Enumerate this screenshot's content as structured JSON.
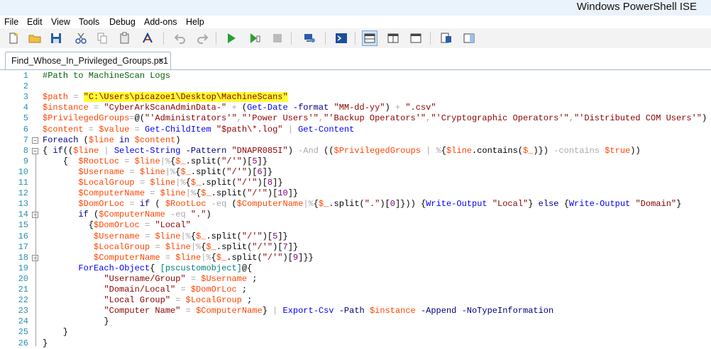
{
  "window": {
    "title": "Windows PowerShell ISE"
  },
  "menu": [
    "File",
    "Edit",
    "View",
    "Tools",
    "Debug",
    "Add-ons",
    "Help"
  ],
  "toolbar_icons": [
    "new-script-icon",
    "open-folder-icon",
    "save-icon",
    "cut-icon",
    "copy-icon",
    "paste-icon",
    "clear-console-icon",
    "undo-icon",
    "redo-icon",
    "run-script-icon",
    "run-selection-icon",
    "stop-icon",
    "new-remote-tab-icon",
    "start-powershell-icon",
    "show-script-top-icon",
    "show-script-right-icon",
    "show-script-maximized-icon",
    "show-script-pane-icon",
    "show-commands-icon"
  ],
  "tab": {
    "label": "Find_Whose_In_Privileged_Groups.ps1",
    "close": "×"
  },
  "colors": {
    "variable": "#ff4500",
    "string": "#8b0000",
    "command": "#0000ff",
    "operator": "#a9a9a9",
    "keyword": "#00008b",
    "type": "#008080",
    "comment": "#006400",
    "highlight": "#ffff33"
  },
  "code_lines": [
    [
      [
        "cmt",
        "#Path to MachineScan Logs"
      ]
    ],
    [],
    [
      [
        "var",
        "$path"
      ],
      [
        "op",
        " = "
      ],
      [
        "str-hl",
        "\"C:\\Users\\picazoe1\\Desktop\\MachineScans\""
      ]
    ],
    [
      [
        "var",
        "$instance"
      ],
      [
        "op",
        " = "
      ],
      [
        "str",
        "\"CyberArkScanAdminData-\""
      ],
      [
        "op",
        " + "
      ],
      [
        "plain",
        "("
      ],
      [
        "cmd",
        "Get-Date"
      ],
      [
        "plain",
        " "
      ],
      [
        "param",
        "-format"
      ],
      [
        "plain",
        " "
      ],
      [
        "str",
        "\"MM-dd-yy\""
      ],
      [
        "plain",
        ")"
      ],
      [
        "op",
        " + "
      ],
      [
        "str",
        "\".csv\""
      ]
    ],
    [
      [
        "var",
        "$PrivilegedGroups"
      ],
      [
        "op",
        "="
      ],
      [
        "plain",
        "@("
      ],
      [
        "str",
        "\"'Administrators'\""
      ],
      [
        "op",
        ","
      ],
      [
        "str",
        "\"'Power Users'\""
      ],
      [
        "op",
        ","
      ],
      [
        "str",
        "\"'Backup Operators'\""
      ],
      [
        "op",
        ","
      ],
      [
        "str",
        "\"'Cryptographic Operators'\""
      ],
      [
        "op",
        ","
      ],
      [
        "str",
        "\"'Distributed COM Users'\""
      ],
      [
        "plain",
        ")"
      ]
    ],
    [
      [
        "var",
        "$content"
      ],
      [
        "op",
        " = "
      ],
      [
        "var",
        "$value"
      ],
      [
        "op",
        " = "
      ],
      [
        "cmd",
        "Get-ChildItem"
      ],
      [
        "plain",
        " "
      ],
      [
        "str",
        "\"$path\\*.log\""
      ],
      [
        "op",
        " | "
      ],
      [
        "cmd",
        "Get-Content"
      ]
    ],
    [
      [
        "kw",
        "Foreach"
      ],
      [
        "plain",
        " ("
      ],
      [
        "var",
        "$line"
      ],
      [
        "plain",
        " "
      ],
      [
        "kw",
        "in"
      ],
      [
        "plain",
        " "
      ],
      [
        "var",
        "$content"
      ],
      [
        "plain",
        ")"
      ]
    ],
    [
      [
        "plain",
        "{ "
      ],
      [
        "kw",
        "if"
      ],
      [
        "plain",
        "(("
      ],
      [
        "var",
        "$line"
      ],
      [
        "op",
        " | "
      ],
      [
        "cmd",
        "Select-String"
      ],
      [
        "plain",
        " "
      ],
      [
        "param",
        "-Pattern"
      ],
      [
        "plain",
        " "
      ],
      [
        "str",
        "\"DNAPR085I\""
      ],
      [
        "plain",
        ")"
      ],
      [
        "op",
        " -And "
      ],
      [
        "plain",
        "(("
      ],
      [
        "var",
        "$PrivilegedGroups"
      ],
      [
        "op",
        " | "
      ],
      [
        "op",
        "%"
      ],
      [
        "plain",
        "{"
      ],
      [
        "var",
        "$line"
      ],
      [
        "plain",
        ".contains("
      ],
      [
        "var",
        "$_"
      ],
      [
        "plain",
        ")})"
      ],
      [
        "op",
        " -contains "
      ],
      [
        "var",
        "$true"
      ],
      [
        "plain",
        "))"
      ]
    ],
    [
      [
        "plain",
        "    {  "
      ],
      [
        "var",
        "$RootLoc"
      ],
      [
        "op",
        " = "
      ],
      [
        "var",
        "$line"
      ],
      [
        "op",
        "|%"
      ],
      [
        "plain",
        "{"
      ],
      [
        "var",
        "$_"
      ],
      [
        "plain",
        ".split("
      ],
      [
        "str",
        "\"/'\""
      ],
      [
        "plain",
        ")["
      ],
      [
        "num",
        "5"
      ],
      [
        "plain",
        "]}"
      ]
    ],
    [
      [
        "plain",
        "       "
      ],
      [
        "var",
        "$Username"
      ],
      [
        "op",
        " = "
      ],
      [
        "var",
        "$line"
      ],
      [
        "op",
        "|%"
      ],
      [
        "plain",
        "{"
      ],
      [
        "var",
        "$_"
      ],
      [
        "plain",
        ".split("
      ],
      [
        "str",
        "\"/'\""
      ],
      [
        "plain",
        ")["
      ],
      [
        "num",
        "6"
      ],
      [
        "plain",
        "]}"
      ]
    ],
    [
      [
        "plain",
        "       "
      ],
      [
        "var",
        "$LocalGroup"
      ],
      [
        "op",
        " = "
      ],
      [
        "var",
        "$line"
      ],
      [
        "op",
        "|%"
      ],
      [
        "plain",
        "{"
      ],
      [
        "var",
        "$_"
      ],
      [
        "plain",
        ".split("
      ],
      [
        "str",
        "\"/'\""
      ],
      [
        "plain",
        ")["
      ],
      [
        "num",
        "8"
      ],
      [
        "plain",
        "]}"
      ]
    ],
    [
      [
        "plain",
        "       "
      ],
      [
        "var",
        "$ComputerName"
      ],
      [
        "op",
        " = "
      ],
      [
        "var",
        "$line"
      ],
      [
        "op",
        "|%"
      ],
      [
        "plain",
        "{"
      ],
      [
        "var",
        "$_"
      ],
      [
        "plain",
        ".split("
      ],
      [
        "str",
        "\"/'\""
      ],
      [
        "plain",
        ")["
      ],
      [
        "num",
        "10"
      ],
      [
        "plain",
        "]}"
      ]
    ],
    [
      [
        "plain",
        "       "
      ],
      [
        "var",
        "$DomOrLoc"
      ],
      [
        "op",
        " = "
      ],
      [
        "kw",
        "if"
      ],
      [
        "plain",
        " ( "
      ],
      [
        "var",
        "$RootLoc"
      ],
      [
        "op",
        " -eq "
      ],
      [
        "plain",
        "("
      ],
      [
        "var",
        "$ComputerName"
      ],
      [
        "op",
        "|%"
      ],
      [
        "plain",
        "{"
      ],
      [
        "var",
        "$_"
      ],
      [
        "plain",
        ".split("
      ],
      [
        "str",
        "\".\""
      ],
      [
        "plain",
        ")["
      ],
      [
        "num",
        "0"
      ],
      [
        "plain",
        "]})) {"
      ],
      [
        "cmd",
        "Write-Output"
      ],
      [
        "plain",
        " "
      ],
      [
        "str",
        "\"Local\""
      ],
      [
        "plain",
        "} "
      ],
      [
        "kw",
        "else"
      ],
      [
        "plain",
        " {"
      ],
      [
        "cmd",
        "Write-Output"
      ],
      [
        "plain",
        " "
      ],
      [
        "str",
        "\"Domain\""
      ],
      [
        "plain",
        "}"
      ]
    ],
    [
      [
        "plain",
        "       "
      ],
      [
        "kw",
        "if"
      ],
      [
        "plain",
        " ("
      ],
      [
        "var",
        "$ComputerName"
      ],
      [
        "op",
        " -eq "
      ],
      [
        "str",
        "\".\""
      ],
      [
        "plain",
        ")"
      ]
    ],
    [
      [
        "plain",
        "         {"
      ],
      [
        "var",
        "$DomOrLoc"
      ],
      [
        "op",
        " = "
      ],
      [
        "str",
        "\"Local\""
      ]
    ],
    [
      [
        "plain",
        "          "
      ],
      [
        "var",
        "$Username"
      ],
      [
        "op",
        " = "
      ],
      [
        "var",
        "$line"
      ],
      [
        "op",
        "|%"
      ],
      [
        "plain",
        "{"
      ],
      [
        "var",
        "$_"
      ],
      [
        "plain",
        ".split("
      ],
      [
        "str",
        "\"/'\""
      ],
      [
        "plain",
        ")["
      ],
      [
        "num",
        "5"
      ],
      [
        "plain",
        "]}"
      ]
    ],
    [
      [
        "plain",
        "          "
      ],
      [
        "var",
        "$LocalGroup"
      ],
      [
        "op",
        " = "
      ],
      [
        "var",
        "$line"
      ],
      [
        "op",
        "|%"
      ],
      [
        "plain",
        "{"
      ],
      [
        "var",
        "$_"
      ],
      [
        "plain",
        ".split("
      ],
      [
        "str",
        "\"/'\""
      ],
      [
        "plain",
        ")["
      ],
      [
        "num",
        "7"
      ],
      [
        "plain",
        "]}"
      ]
    ],
    [
      [
        "plain",
        "          "
      ],
      [
        "var",
        "$ComputerName"
      ],
      [
        "op",
        " = "
      ],
      [
        "var",
        "$line"
      ],
      [
        "op",
        "|%"
      ],
      [
        "plain",
        "{"
      ],
      [
        "var",
        "$_"
      ],
      [
        "plain",
        ".split("
      ],
      [
        "str",
        "\"/'\""
      ],
      [
        "plain",
        ")["
      ],
      [
        "num",
        "9"
      ],
      [
        "plain",
        "]}}"
      ]
    ],
    [
      [
        "plain",
        "       "
      ],
      [
        "cmd",
        "ForEach-Object"
      ],
      [
        "plain",
        "{ "
      ],
      [
        "type",
        "[pscustomobject]"
      ],
      [
        "plain",
        "@{"
      ]
    ],
    [
      [
        "plain",
        "            "
      ],
      [
        "str",
        "\"Username/Group\""
      ],
      [
        "op",
        " = "
      ],
      [
        "var",
        "$Username"
      ],
      [
        "plain",
        " ;"
      ]
    ],
    [
      [
        "plain",
        "            "
      ],
      [
        "str",
        "\"Domain/Local\""
      ],
      [
        "op",
        " = "
      ],
      [
        "var",
        "$DomOrLoc"
      ],
      [
        "plain",
        " ;"
      ]
    ],
    [
      [
        "plain",
        "            "
      ],
      [
        "str",
        "\"Local Group\""
      ],
      [
        "op",
        " = "
      ],
      [
        "var",
        "$LocalGroup"
      ],
      [
        "plain",
        " ;"
      ]
    ],
    [
      [
        "plain",
        "            "
      ],
      [
        "str",
        "\"Computer Name\""
      ],
      [
        "op",
        " = "
      ],
      [
        "var",
        "$ComputerName"
      ],
      [
        "plain",
        "}"
      ],
      [
        "op",
        " | "
      ],
      [
        "cmd",
        "Export-Csv"
      ],
      [
        "plain",
        " "
      ],
      [
        "param",
        "-Path"
      ],
      [
        "plain",
        " "
      ],
      [
        "var",
        "$instance"
      ],
      [
        "plain",
        " "
      ],
      [
        "param",
        "-Append"
      ],
      [
        "plain",
        " "
      ],
      [
        "param",
        "-NoTypeInformation"
      ]
    ],
    [
      [
        "plain",
        "            }"
      ]
    ],
    [
      [
        "plain",
        "    }"
      ]
    ],
    [
      [
        "plain",
        "}"
      ]
    ]
  ],
  "fold_markers": {
    "7": "−",
    "8": "−",
    "14": "−",
    "18": "−"
  }
}
